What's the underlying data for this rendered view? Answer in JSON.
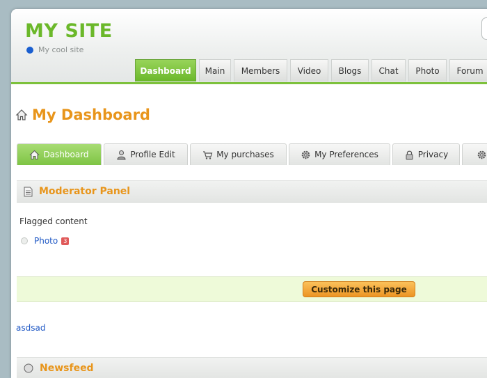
{
  "site": {
    "title": "MY SITE",
    "tagline": "My cool site"
  },
  "topnav": [
    {
      "label": "Dashboard",
      "active": true
    },
    {
      "label": "Main"
    },
    {
      "label": "Members"
    },
    {
      "label": "Video"
    },
    {
      "label": "Blogs"
    },
    {
      "label": "Chat"
    },
    {
      "label": "Photo"
    },
    {
      "label": "Forum"
    }
  ],
  "page": {
    "heading": "My Dashboard"
  },
  "subtabs": [
    {
      "label": "Dashboard",
      "icon": "home-icon",
      "active": true
    },
    {
      "label": "Profile Edit",
      "icon": "user-icon"
    },
    {
      "label": "My purchases",
      "icon": "cart-icon"
    },
    {
      "label": "My Preferences",
      "icon": "gear-icon"
    },
    {
      "label": "Privacy",
      "icon": "lock-icon"
    },
    {
      "label": "",
      "icon": "gear-icon"
    }
  ],
  "moderator_panel": {
    "title": "Moderator Panel",
    "flagged_label": "Flagged content",
    "items": [
      {
        "label": "Photo",
        "count": "3"
      }
    ]
  },
  "customize": {
    "button_label": "Customize this page"
  },
  "links": {
    "asdsad": "asdsad"
  },
  "newsfeed": {
    "title": "Newsfeed"
  },
  "colors": {
    "accent_green": "#6bb82a",
    "accent_orange": "#e8951b",
    "link_blue": "#1f58c5"
  }
}
